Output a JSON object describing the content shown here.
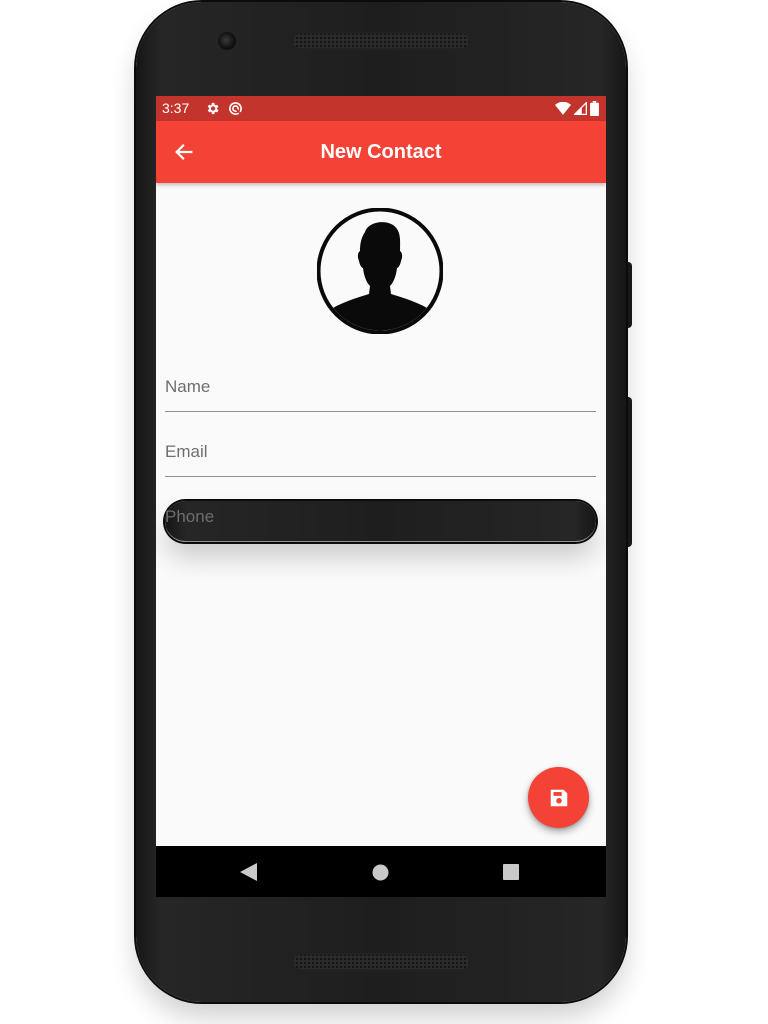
{
  "status_bar": {
    "time": "3:37",
    "icons": [
      "gear-icon",
      "sync-icon",
      "wifi-icon",
      "signal-icon",
      "battery-icon"
    ],
    "background": "#c3352c"
  },
  "app_bar": {
    "title": "New Contact",
    "back_icon": "arrow-left-icon",
    "background": "#f44236"
  },
  "avatar": {
    "icon": "person-silhouette-icon"
  },
  "form": {
    "name_placeholder": "Name",
    "email_placeholder": "Email",
    "phone_placeholder": "Phone"
  },
  "fab": {
    "icon": "save-icon",
    "color": "#f44236"
  },
  "nav_bar": {
    "icons": [
      "nav-back-icon",
      "nav-home-icon",
      "nav-recents-icon"
    ]
  }
}
